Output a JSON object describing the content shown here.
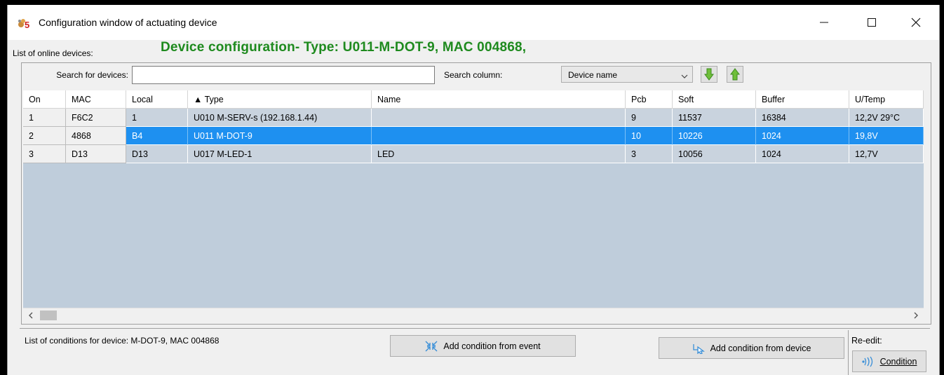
{
  "window": {
    "title": "Configuration window of actuating device",
    "app_icon": "app-icon"
  },
  "labels": {
    "online_devices": "List of online devices:",
    "device_config": "Device configuration- Type: U011-M-DOT-9, MAC 004868,",
    "search_for_devices": "Search for devices:",
    "search_column": "Search column:"
  },
  "search": {
    "value": "",
    "placeholder": ""
  },
  "search_column": {
    "selected": "Device name"
  },
  "table": {
    "columns": [
      "On",
      "MAC",
      "Local",
      "▲ Type",
      "Name",
      "Pcb",
      "Soft",
      "Buffer",
      "U/Temp"
    ],
    "rows": [
      [
        "1",
        "F6C2",
        "1",
        "U010 M-SERV-s (192.168.1.44)",
        "",
        "9",
        "11537",
        "16384",
        "12,2V 29°C"
      ],
      [
        "2",
        "4868",
        "B4",
        "U011 M-DOT-9",
        "",
        "10",
        "10226",
        "1024",
        "19,8V"
      ],
      [
        "3",
        "D13",
        "D13",
        "U017 M-LED-1",
        "LED",
        "3",
        "10056",
        "1024",
        "12,7V"
      ]
    ],
    "selected_row": 1
  },
  "bottom": {
    "conditions_label": "List of conditions for device: M-DOT-9, MAC 004868",
    "add_from_event": "Add condition from event",
    "add_from_device": "Add condition from device",
    "reedit": "Re-edit:",
    "condition": "Condition"
  },
  "colors": {
    "header_green": "#1e8a1e",
    "selection": "#1e90f0",
    "grid_bg": "#bfcddb"
  }
}
